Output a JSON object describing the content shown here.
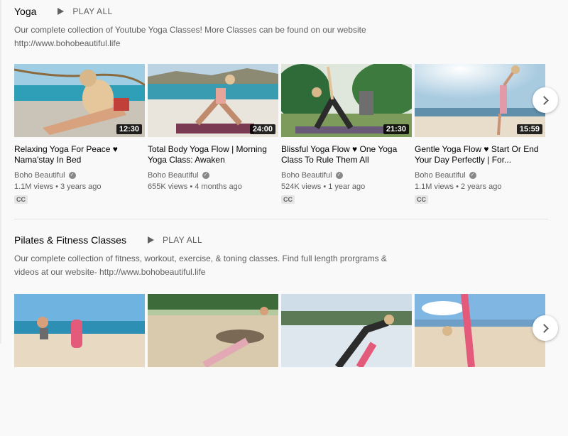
{
  "shelves": [
    {
      "title": "Yoga",
      "play_all": "PLAY ALL",
      "description": "Our complete collection of Youtube Yoga Classes! More Classes can be found on our website http://www.bohobeautiful.life",
      "videos": [
        {
          "title": "Relaxing Yoga For Peace ♥ Nama'stay In Bed",
          "duration": "12:30",
          "channel": "Boho Beautiful",
          "views": "1.1M views",
          "age": "3 years ago",
          "cc": "CC"
        },
        {
          "title": "Total Body Yoga Flow | Morning Yoga Class: Awaken",
          "duration": "24:00",
          "channel": "Boho Beautiful",
          "views": "655K views",
          "age": "4 months ago"
        },
        {
          "title": "Blissful Yoga Flow ♥ One Yoga Class To Rule Them All",
          "duration": "21:30",
          "channel": "Boho Beautiful",
          "views": "524K views",
          "age": "1 year ago",
          "cc": "CC"
        },
        {
          "title": "Gentle Yoga Flow ♥ Start Or End Your Day Perfectly | For...",
          "duration": "15:59",
          "channel": "Boho Beautiful",
          "views": "1.1M views",
          "age": "2 years ago",
          "cc": "CC"
        }
      ]
    },
    {
      "title": "Pilates & Fitness Classes",
      "play_all": "PLAY ALL",
      "description": "Our complete collection of fitness, workout, exercise, & toning classes. Find full length prorgrams & videos at our website- http://www.bohobeautiful.life"
    }
  ],
  "icons": {
    "verified": "check-circle-icon",
    "play": "play-icon",
    "next": "chevron-right-icon"
  },
  "colors": {
    "text": "#030303",
    "secondary": "#606060",
    "background": "#f9f9f9"
  }
}
